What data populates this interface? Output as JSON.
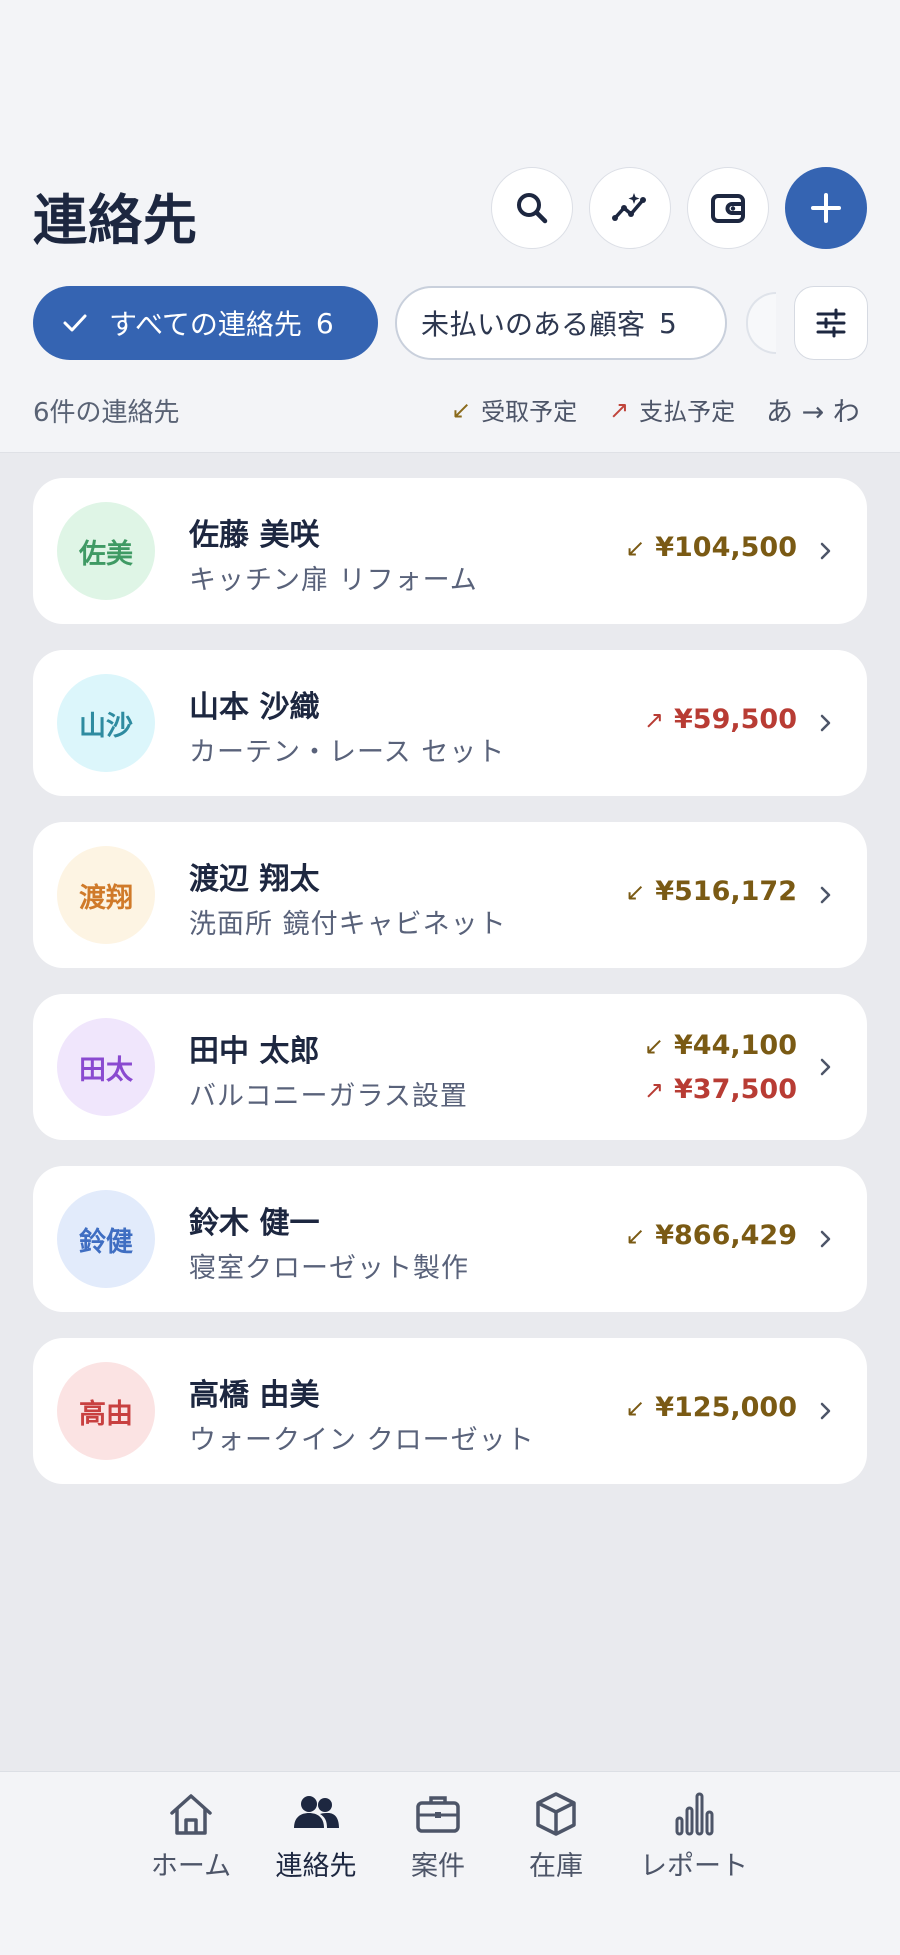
{
  "header": {
    "title": "連絡先",
    "actions": [
      {
        "name": "search-icon"
      },
      {
        "name": "sparkle-chart-icon"
      },
      {
        "name": "wallet-icon"
      },
      {
        "name": "plus-icon"
      }
    ]
  },
  "filters": {
    "all_label": "すべての連絡先",
    "all_count": "6",
    "unpaid_label": "未払いのある顧客",
    "unpaid_count": "5"
  },
  "summary": {
    "count_text": "6件の連絡先",
    "legend_receive": "受取予定",
    "legend_pay": "支払予定",
    "sort_text": "あ → わ",
    "receive_arrow": "↙",
    "pay_arrow": "↗"
  },
  "contacts": [
    {
      "initials": "佐美",
      "name": "佐藤 美咲",
      "project": "キッチン扉 リフォーム",
      "amounts": [
        {
          "dir": "receive",
          "value": "¥104,500"
        }
      ],
      "avatar_bg": "#dff5e6",
      "avatar_fg": "#3f9a64"
    },
    {
      "initials": "山沙",
      "name": "山本 沙織",
      "project": "カーテン・レース セット",
      "amounts": [
        {
          "dir": "pay",
          "value": "¥59,500"
        }
      ],
      "avatar_bg": "#dcf6fb",
      "avatar_fg": "#2e8ba0"
    },
    {
      "initials": "渡翔",
      "name": "渡辺 翔太",
      "project": "洗面所 鏡付キャビネット",
      "amounts": [
        {
          "dir": "receive",
          "value": "¥516,172"
        }
      ],
      "avatar_bg": "#fdf4e3",
      "avatar_fg": "#d07a2a"
    },
    {
      "initials": "田太",
      "name": "田中 太郎",
      "project": "バルコニーガラス設置",
      "amounts": [
        {
          "dir": "receive",
          "value": "¥44,100"
        },
        {
          "dir": "pay",
          "value": "¥37,500"
        }
      ],
      "avatar_bg": "#f0e6fc",
      "avatar_fg": "#8a4ad0"
    },
    {
      "initials": "鈴健",
      "name": "鈴木 健一",
      "project": "寝室クローゼット製作",
      "amounts": [
        {
          "dir": "receive",
          "value": "¥866,429"
        }
      ],
      "avatar_bg": "#e2ebfb",
      "avatar_fg": "#3f6ec2"
    },
    {
      "initials": "高由",
      "name": "高橋 由美",
      "project": "ウォークイン クローゼット",
      "amounts": [
        {
          "dir": "receive",
          "value": "¥125,000"
        }
      ],
      "avatar_bg": "#fbe3e3",
      "avatar_fg": "#c84040"
    }
  ],
  "nav": [
    {
      "label": "ホーム",
      "icon": "home-icon"
    },
    {
      "label": "連絡先",
      "icon": "contacts-icon",
      "active": true
    },
    {
      "label": "案件",
      "icon": "briefcase-icon"
    },
    {
      "label": "在庫",
      "icon": "box-icon"
    },
    {
      "label": "レポート",
      "icon": "bar-chart-icon"
    }
  ],
  "colors": {
    "accent": "#3564b2",
    "receive": "#7a5a14",
    "pay": "#b83c34"
  }
}
